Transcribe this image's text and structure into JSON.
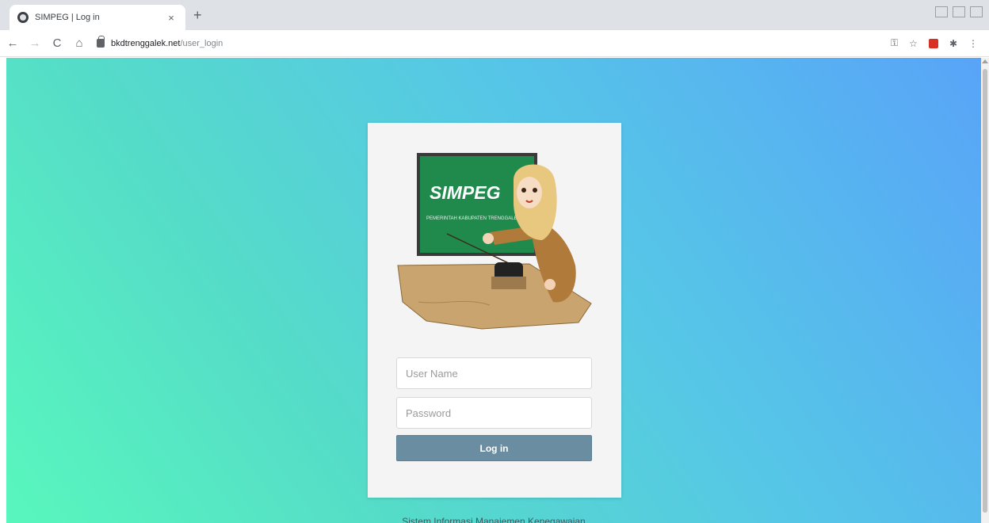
{
  "browser": {
    "tab_title": "SIMPEG | Log in",
    "tab_close": "×",
    "new_tab": "+",
    "url_host": "bkdtrenggalek.net",
    "url_path": "/user_login",
    "nav": {
      "back": "←",
      "forward": "→",
      "reload": "C",
      "home": "⌂"
    },
    "extensions": {
      "key": "⚿",
      "star": "☆",
      "puzzle": "✱",
      "menu": "⋮"
    }
  },
  "login": {
    "logo_text": "SIMPEG",
    "logo_subtext": "PEMERINTAH KABUPATEN TRENGGALEK",
    "username_placeholder": "User Name",
    "password_placeholder": "Password",
    "button_label": "Log in"
  },
  "footer": {
    "text": "Sistem Informasi Manajemen Kepegawaian"
  },
  "colors": {
    "gradient_start": "#58f7bd",
    "gradient_end": "#58a4f8",
    "button": "#6a8da1",
    "card": "#f4f4f5"
  }
}
